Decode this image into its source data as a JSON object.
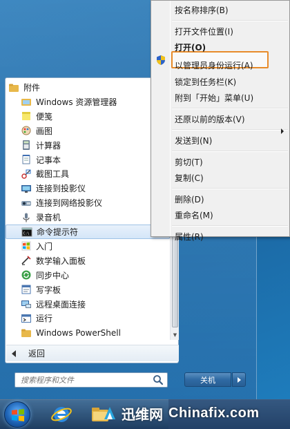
{
  "start_menu": {
    "programs": [
      {
        "label": "附件",
        "icon": "folder-icon",
        "level": "top"
      },
      {
        "label": "Windows 资源管理器",
        "icon": "explorer-icon",
        "level": "sub"
      },
      {
        "label": "便笺",
        "icon": "sticky-notes-icon",
        "level": "sub"
      },
      {
        "label": "画图",
        "icon": "paint-icon",
        "level": "sub"
      },
      {
        "label": "计算器",
        "icon": "calculator-icon",
        "level": "sub"
      },
      {
        "label": "记事本",
        "icon": "notepad-icon",
        "level": "sub"
      },
      {
        "label": "截图工具",
        "icon": "snipping-tool-icon",
        "level": "sub"
      },
      {
        "label": "连接到投影仪",
        "icon": "projector-icon",
        "level": "sub"
      },
      {
        "label": "连接到网络投影仪",
        "icon": "network-projector-icon",
        "level": "sub"
      },
      {
        "label": "录音机",
        "icon": "sound-recorder-icon",
        "level": "sub"
      },
      {
        "label": "命令提示符",
        "icon": "command-prompt-icon",
        "level": "sub",
        "selected": true
      },
      {
        "label": "入门",
        "icon": "getting-started-icon",
        "level": "sub"
      },
      {
        "label": "数学输入面板",
        "icon": "math-input-icon",
        "level": "sub"
      },
      {
        "label": "同步中心",
        "icon": "sync-center-icon",
        "level": "sub"
      },
      {
        "label": "写字板",
        "icon": "wordpad-icon",
        "level": "sub"
      },
      {
        "label": "远程桌面连接",
        "icon": "remote-desktop-icon",
        "level": "sub"
      },
      {
        "label": "运行",
        "icon": "run-icon",
        "level": "sub"
      },
      {
        "label": "Windows PowerShell",
        "icon": "folder-icon",
        "level": "sub"
      }
    ],
    "back_label": "返回",
    "search_placeholder": "搜索程序和文件",
    "shutdown_label": "关机"
  },
  "context_menu": {
    "items": [
      {
        "label": "按名称排序(B)"
      },
      {
        "separator": true
      },
      {
        "label": "打开文件位置(I)"
      },
      {
        "label": "打开(O)",
        "bold": true
      },
      {
        "label": "以管理员身份运行(A)",
        "highlighted": true,
        "icon": "uac-shield-icon"
      },
      {
        "label": "锁定到任务栏(K)"
      },
      {
        "label": "附到「开始」菜单(U)"
      },
      {
        "separator": true
      },
      {
        "label": "还原以前的版本(V)"
      },
      {
        "separator": true
      },
      {
        "label": "发送到(N)",
        "submenu": true
      },
      {
        "separator": true
      },
      {
        "label": "剪切(T)"
      },
      {
        "label": "复制(C)"
      },
      {
        "separator": true
      },
      {
        "label": "删除(D)"
      },
      {
        "label": "重命名(M)"
      },
      {
        "separator": true
      },
      {
        "label": "属性(R)"
      }
    ],
    "highlight_color": "#e88b2a"
  },
  "watermark": {
    "text1": "迅维网",
    "text2": "Chinafix.com"
  },
  "colors": {
    "selection": "#d4e6f8",
    "taskbar": "#1e3c5f"
  }
}
